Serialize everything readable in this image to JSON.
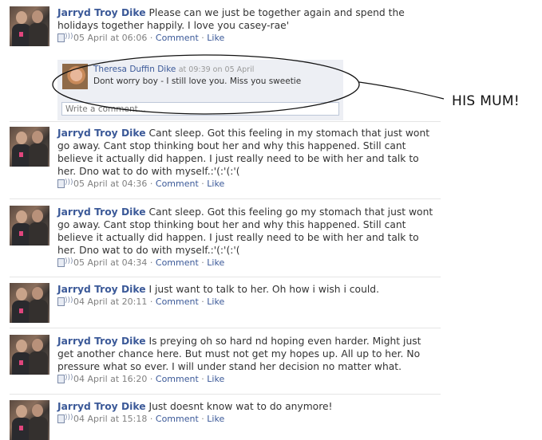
{
  "posts": [
    {
      "author": "Jarryd Troy Dike",
      "text": "Please can we just be together again and spend the holidays together happily. I love you casey-rae'",
      "time": "05 April at 06:06",
      "comment_label": "Comment",
      "like_label": "Like"
    },
    {
      "author": "Jarryd Troy Dike",
      "text": "Cant sleep. Got this feeling in my stomach that just wont go away. Cant stop thinking bout her and why this happened. Still cant believe it actually did happen. I just really need to be with her and talk to her. Dno wat to do with myself.:'(:'(:'(",
      "time": "05 April at 04:36",
      "comment_label": "Comment",
      "like_label": "Like"
    },
    {
      "author": "Jarryd Troy Dike",
      "text": "Cant sleep. Got this feeling go my stomach that just wont go away. Cant stop thinking bout her and why this happened. Still cant believe it actually did happen. I just really need to be with her and talk to her. Dno wat to do with myself.:'(:'(:'(",
      "time": "05 April at 04:34",
      "comment_label": "Comment",
      "like_label": "Like"
    },
    {
      "author": "Jarryd Troy Dike",
      "text": "I just want to talk to her. Oh how i wish i could.",
      "time": "04 April at 20:11",
      "comment_label": "Comment",
      "like_label": "Like"
    },
    {
      "author": "Jarryd Troy Dike",
      "text": "Is preying oh so hard nd hoping even harder. Might just get another chance here. But must not get my hopes up. All up to her. No pressure what so ever. I will under stand her decision no matter what.",
      "time": "04 April at 16:20",
      "comment_label": "Comment",
      "like_label": "Like"
    },
    {
      "author": "Jarryd Troy Dike",
      "text": "Just doesnt know wat to do anymore!",
      "time": "04 April at 15:18",
      "comment_label": "Comment",
      "like_label": "Like"
    }
  ],
  "comment": {
    "author": "Theresa Duffin Dike",
    "when": "at 09:39 on 05 April",
    "text": "Dont worry boy - I still love you. Miss you sweetie",
    "input_placeholder": "Write a comment..."
  },
  "annotation": "HIS MUM!",
  "meta_separator": " · ",
  "icons": {
    "avatar": "profile-photo",
    "source": "mobile-post-icon"
  },
  "colors": {
    "link": "#3b5998",
    "comment_bg": "#edeff4",
    "meta_text": "#808080"
  }
}
